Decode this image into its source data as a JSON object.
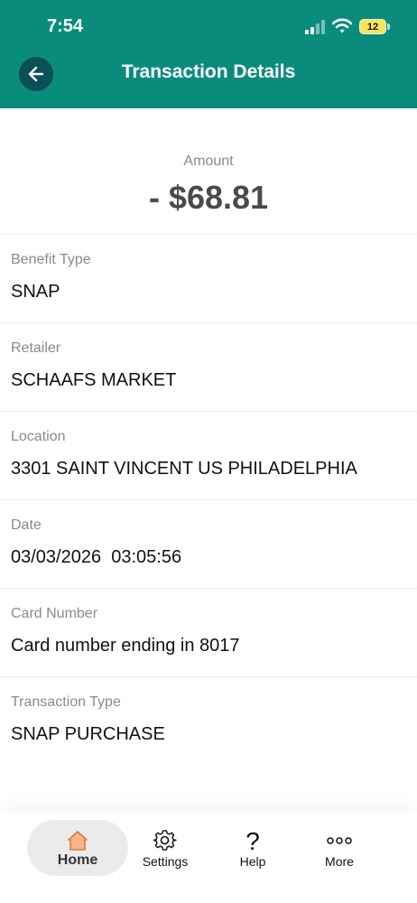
{
  "status_bar": {
    "time": "7:54",
    "battery": "12"
  },
  "header": {
    "title": "Transaction Details",
    "background_color": "#0a8c7c",
    "back_icon": "arrow-left-icon"
  },
  "amount": {
    "label": "Amount",
    "value": "- $68.81"
  },
  "fields": [
    {
      "label": "Benefit Type",
      "value": "SNAP"
    },
    {
      "label": "Retailer",
      "value": "SCHAAFS MARKET"
    },
    {
      "label": "Location",
      "value": "3301 SAINT VINCENT US PHILADELPHIA"
    },
    {
      "label": "Date",
      "value": "03/03/2026  03:05:56"
    },
    {
      "label": "Card Number",
      "value": "Card number ending in 8017"
    },
    {
      "label": "Transaction Type",
      "value": "SNAP PURCHASE"
    }
  ],
  "tab_bar": {
    "tabs": [
      {
        "label": "Home",
        "icon": "home-icon",
        "selected": true
      },
      {
        "label": "Settings",
        "icon": "gear-icon",
        "selected": false
      },
      {
        "label": "Help",
        "icon": "question-icon",
        "selected": false
      },
      {
        "label": "More",
        "icon": "more-icon",
        "selected": false
      }
    ],
    "accent_color": "#f0a070"
  }
}
